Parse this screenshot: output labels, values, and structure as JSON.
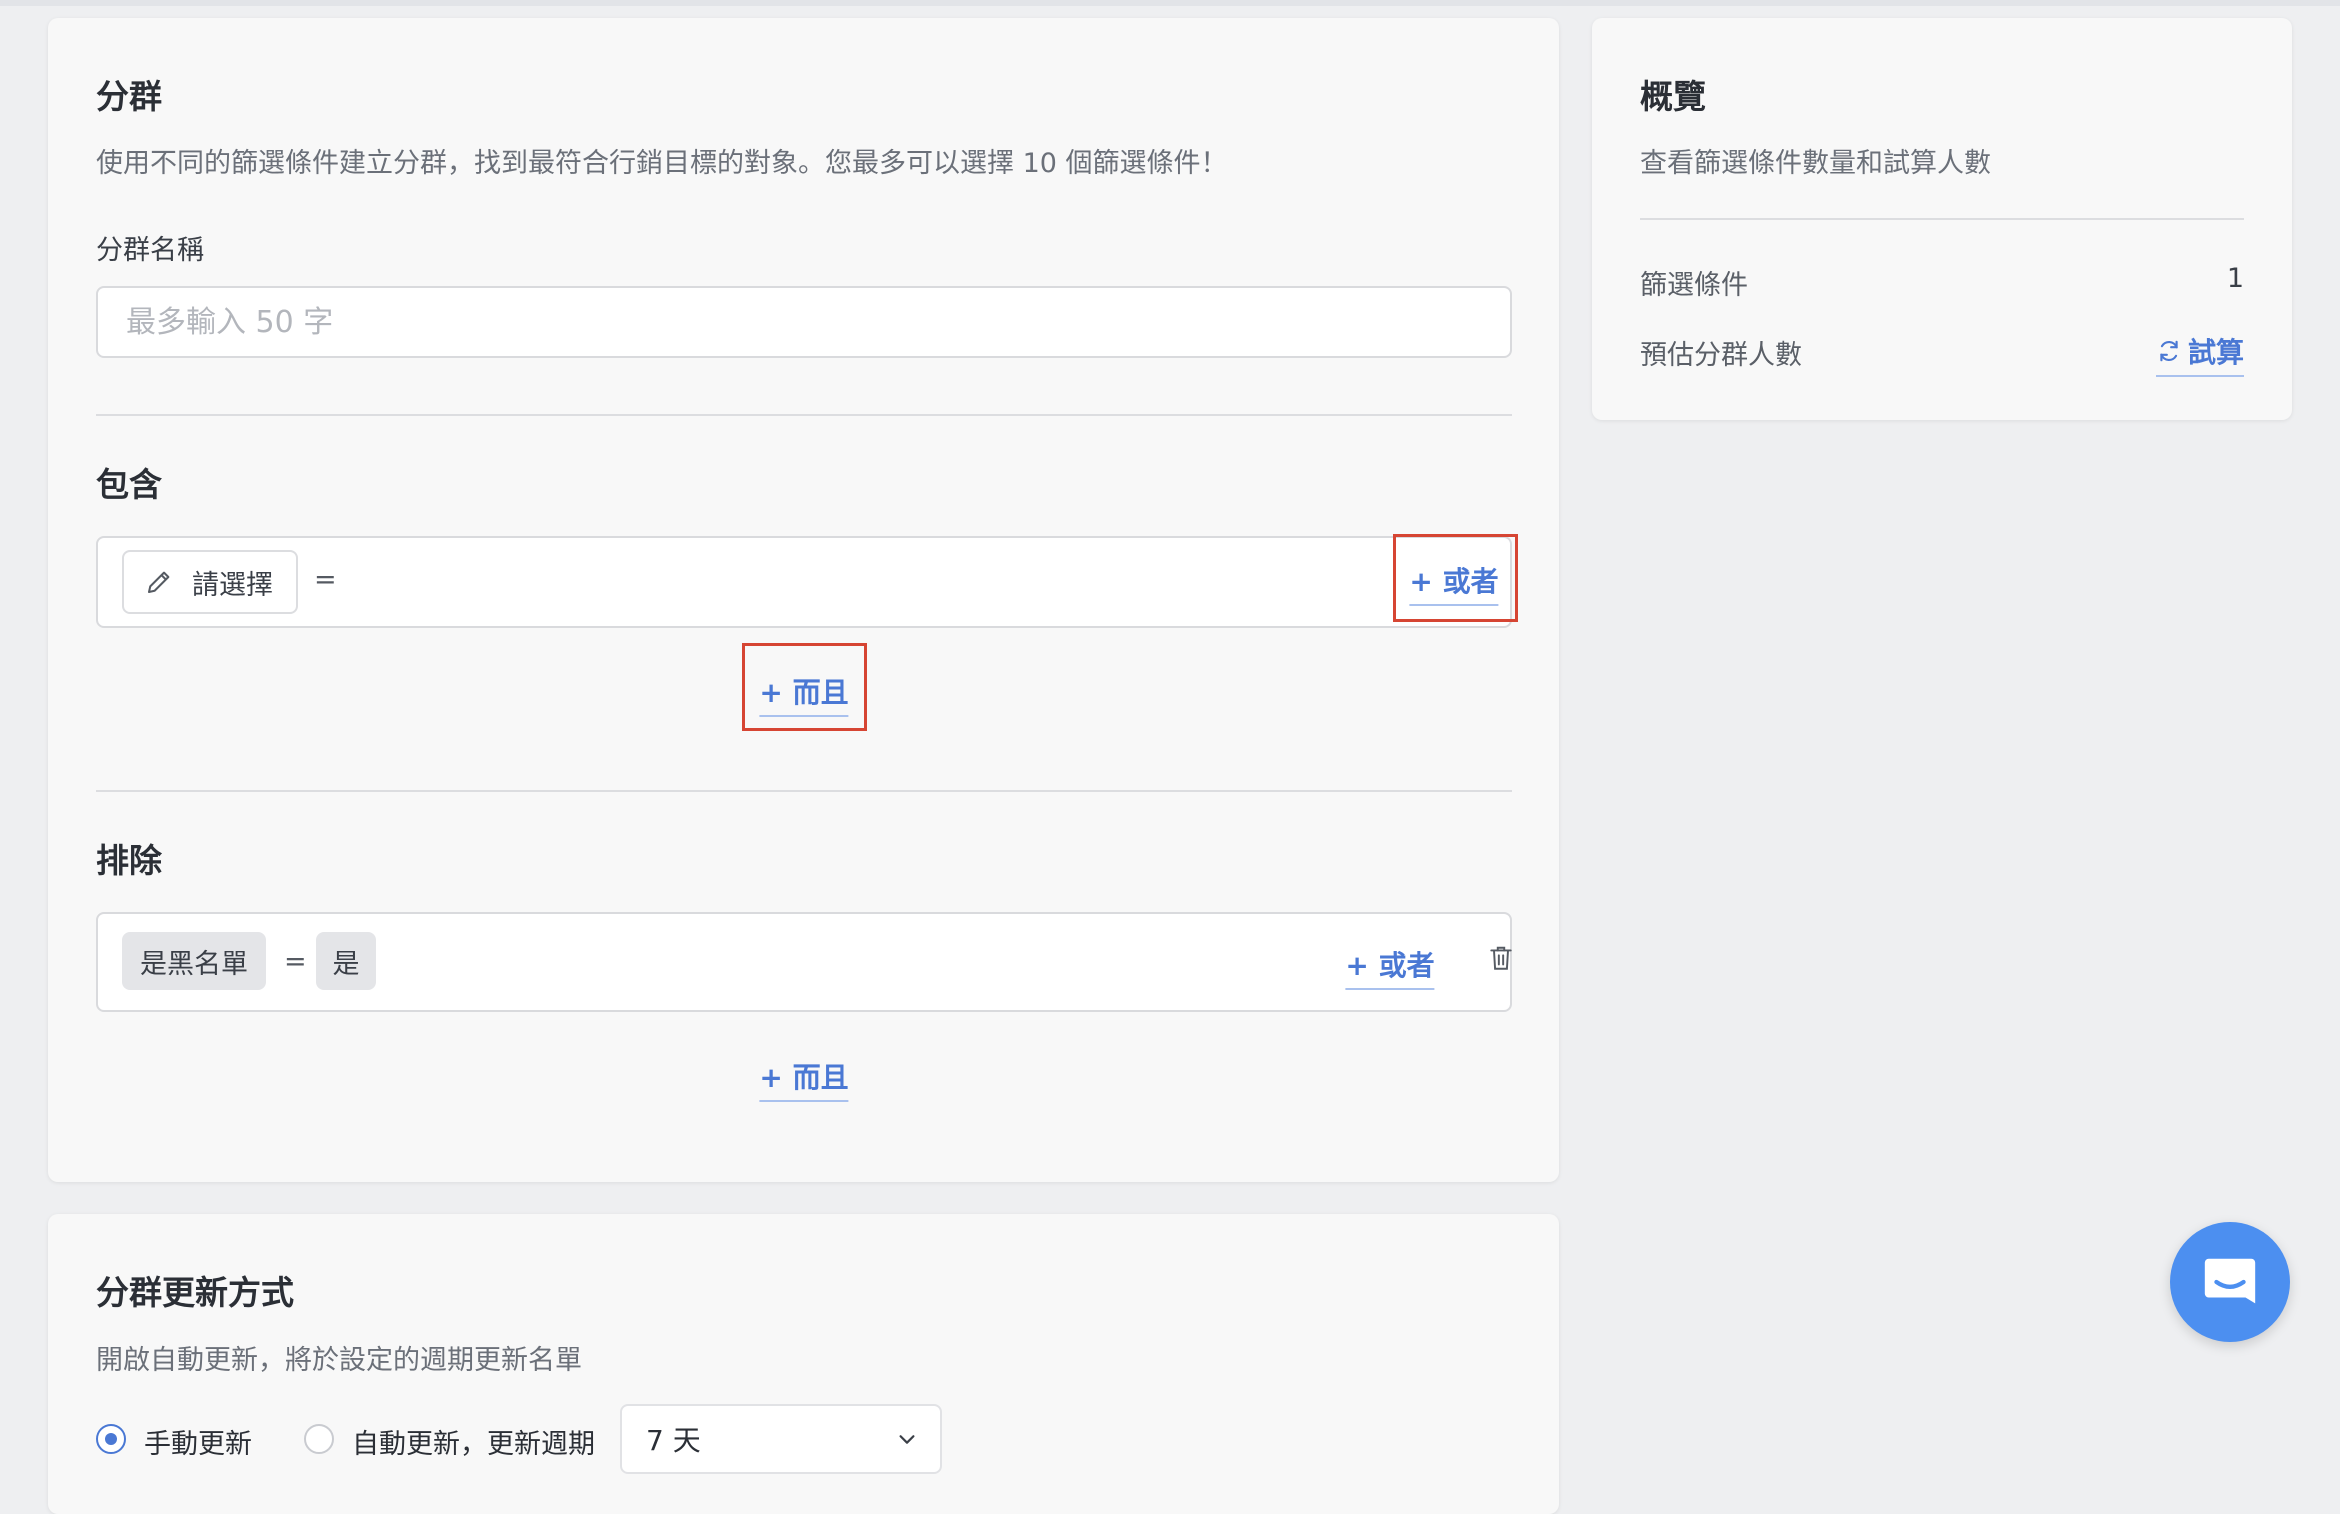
{
  "segment": {
    "title": "分群",
    "description": "使用不同的篩選條件建立分群，找到最符合行銷目標的對象。您最多可以選擇 10 個篩選條件！",
    "name_label": "分群名稱",
    "name_placeholder": "最多輸入 50 字",
    "name_value": ""
  },
  "include": {
    "title": "包含",
    "rule": {
      "select_label": "請選擇",
      "operator": "=",
      "icon": "pencil-icon"
    },
    "or_label": "+ 或者",
    "and_label": "+ 而且"
  },
  "exclude": {
    "title": "排除",
    "rule": {
      "field": "是黑名單",
      "operator": "=",
      "value": "是",
      "icon": "trash-icon"
    },
    "or_label": "+ 或者",
    "and_label": "+ 而且"
  },
  "overview": {
    "title": "概覽",
    "description": "查看篩選條件數量和試算人數",
    "filter_count_label": "篩選條件",
    "filter_count_value": "1",
    "estimate_label": "預估分群人數",
    "estimate_action": "試算",
    "estimate_icon": "refresh-icon"
  },
  "update": {
    "title": "分群更新方式",
    "description": "開啟自動更新，將於設定的週期更新名單",
    "manual_label": "手動更新",
    "auto_label": "自動更新，更新週期",
    "selected": "manual",
    "period_value": "7 天",
    "period_icon": "chevron-down-icon"
  },
  "chat": {
    "icon": "chat-bubble-icon"
  },
  "colors": {
    "accent": "#4a78d4",
    "highlight": "#d64533",
    "chat": "#4c8ff0"
  }
}
